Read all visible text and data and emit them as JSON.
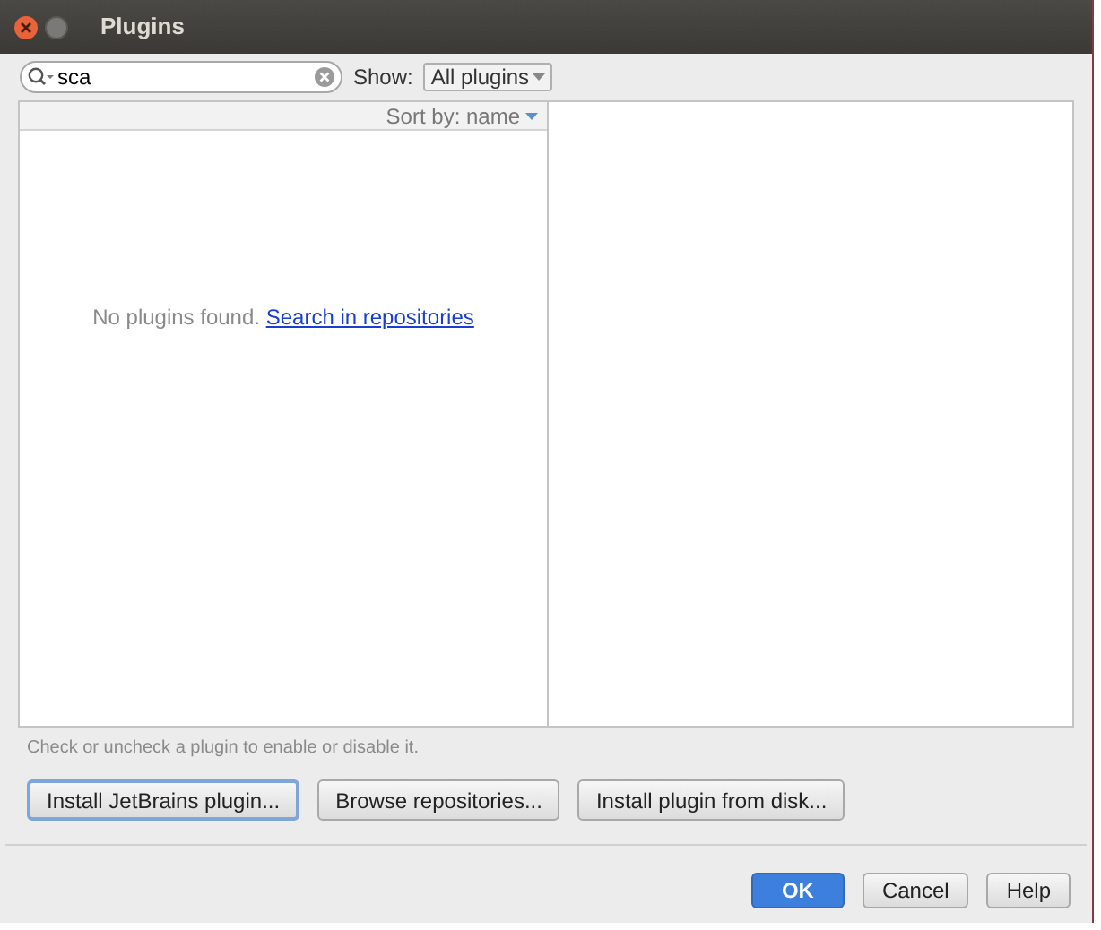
{
  "window": {
    "title": "Plugins"
  },
  "search": {
    "value": "sca"
  },
  "show": {
    "label": "Show:",
    "value": "All plugins"
  },
  "list": {
    "sort": "Sort by: name",
    "empty_text": "No plugins found.",
    "empty_link": "Search in repositories"
  },
  "hint": "Check or uncheck a plugin to enable or disable it.",
  "actions": [
    {
      "label": "Install JetBrains plugin...",
      "focused": true
    },
    {
      "label": "Browse repositories...",
      "focused": false
    },
    {
      "label": "Install plugin from disk...",
      "focused": false
    }
  ],
  "buttons": [
    {
      "label": "OK",
      "default": true
    },
    {
      "label": "Cancel",
      "default": false
    },
    {
      "label": "Help",
      "default": false
    }
  ]
}
